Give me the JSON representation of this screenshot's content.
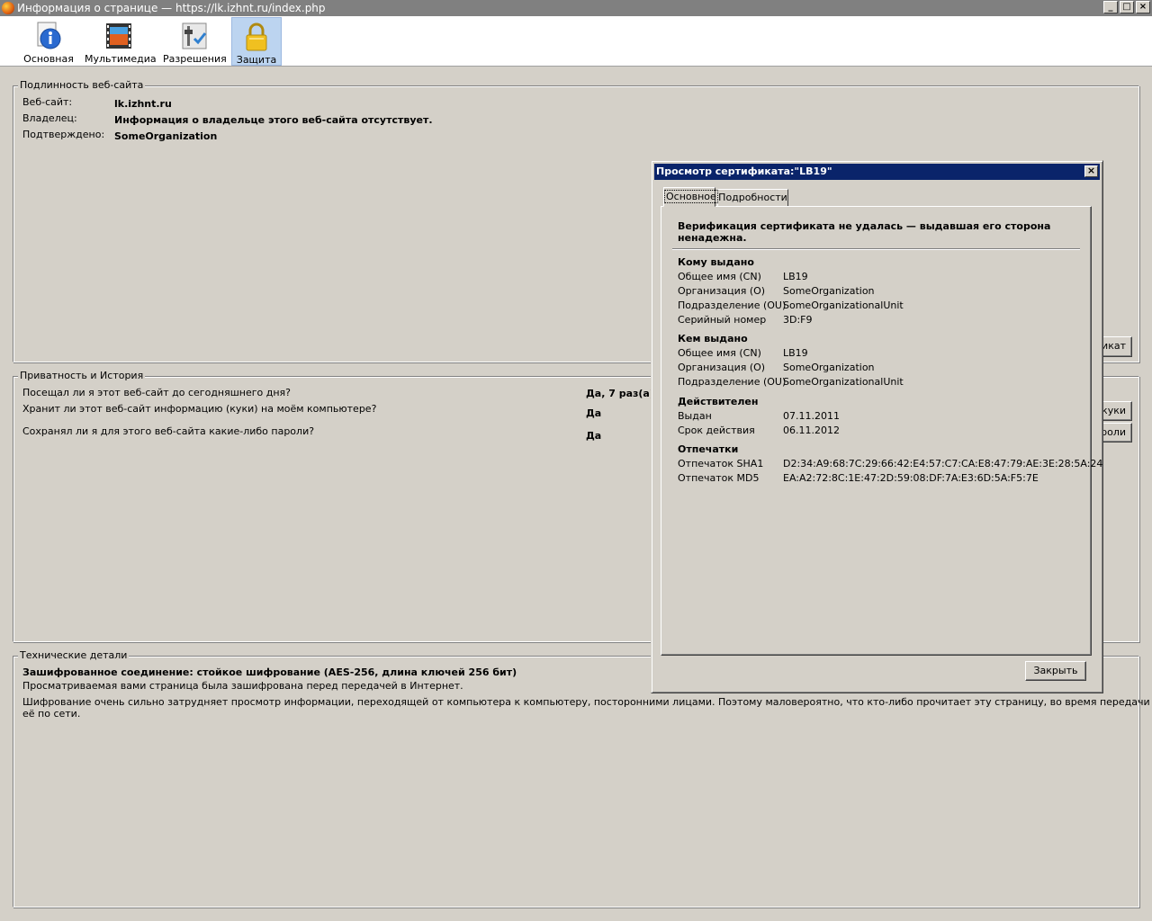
{
  "window": {
    "title": "Информация о странице — https://lk.izhnt.ru/index.php",
    "buttons": {
      "minimize": "_",
      "maximize": "□",
      "close": "×"
    }
  },
  "toolbar": {
    "items": [
      {
        "label": "Основная",
        "icon": "info-icon"
      },
      {
        "label": "Мультимедиа",
        "icon": "media-icon"
      },
      {
        "label": "Разрешения",
        "icon": "permissions-icon"
      },
      {
        "label": "Защита",
        "icon": "lock-icon",
        "selected": true
      }
    ]
  },
  "identity": {
    "legend": "Подлинность веб-сайта",
    "website_label": "Веб-сайт:",
    "website_value": "lk.izhnt.ru",
    "owner_label": "Владелец:",
    "owner_value": "Информация о владельце этого веб-сайта отсутствует.",
    "verified_label": "Подтверждено:",
    "verified_value": "SomeOrganization",
    "view_cert_button_visible": "икат"
  },
  "privacy": {
    "legend": "Приватность и История",
    "q1": "Посещал ли я этот веб-сайт до сегодняшнего дня?",
    "a1": "Да, 7 раз(а)",
    "q2": "Хранит ли этот веб-сайт информацию (куки) на моём компьютере?",
    "a2": "Да",
    "q3": "Сохранял ли я для этого веб-сайта какие-либо пароли?",
    "a3": "Да",
    "cookies_button_visible": "куки",
    "passwords_button_visible": "ароли"
  },
  "technical": {
    "legend": "Технические детали",
    "headline": "Зашифрованное соединение: стойкое шифрование (AES-256, длина ключей 256 бит)",
    "line1": "Просматриваемая вами страница была зашифрована перед передачей в Интернет.",
    "line2": "Шифрование очень сильно затрудняет просмотр информации, переходящей от компьютера к компьютеру, посторонними лицами. Поэтому маловероятно, что кто-либо прочитает эту страницу, во время передачи её по сети."
  },
  "cert_dialog": {
    "title": "Просмотр сертификата:\"LB19\"",
    "close_glyph": "×",
    "tabs": [
      "Основное",
      "Подробности"
    ],
    "warning": "Верификация сертификата не удалась — выдавшая его сторона ненадежна.",
    "issued_to": {
      "heading": "Кому выдано",
      "rows": [
        {
          "k": "Общее имя (CN)",
          "v": "LB19"
        },
        {
          "k": "Организация (O)",
          "v": "SomeOrganization"
        },
        {
          "k": "Подразделение (OU)",
          "v": "SomeOrganizationalUnit"
        },
        {
          "k": "Серийный номер",
          "v": "3D:F9"
        }
      ]
    },
    "issued_by": {
      "heading": "Кем выдано",
      "rows": [
        {
          "k": "Общее имя (CN)",
          "v": "LB19"
        },
        {
          "k": "Организация (O)",
          "v": "SomeOrganization"
        },
        {
          "k": "Подразделение (OU)",
          "v": "SomeOrganizationalUnit"
        }
      ]
    },
    "validity": {
      "heading": "Действителен",
      "rows": [
        {
          "k": "Выдан",
          "v": "07.11.2011"
        },
        {
          "k": "Срок действия",
          "v": "06.11.2012"
        }
      ]
    },
    "fingerprints": {
      "heading": "Отпечатки",
      "rows": [
        {
          "k": "Отпечаток SHA1",
          "v": "D2:34:A9:68:7C:29:66:42:E4:57:C7:CA:E8:47:79:AE:3E:28:5A:24"
        },
        {
          "k": "Отпечаток MD5",
          "v": "EA:A2:72:8C:1E:47:2D:59:08:DF:7A:E3:6D:5A:F5:7E"
        }
      ]
    },
    "close_button": "Закрыть"
  }
}
